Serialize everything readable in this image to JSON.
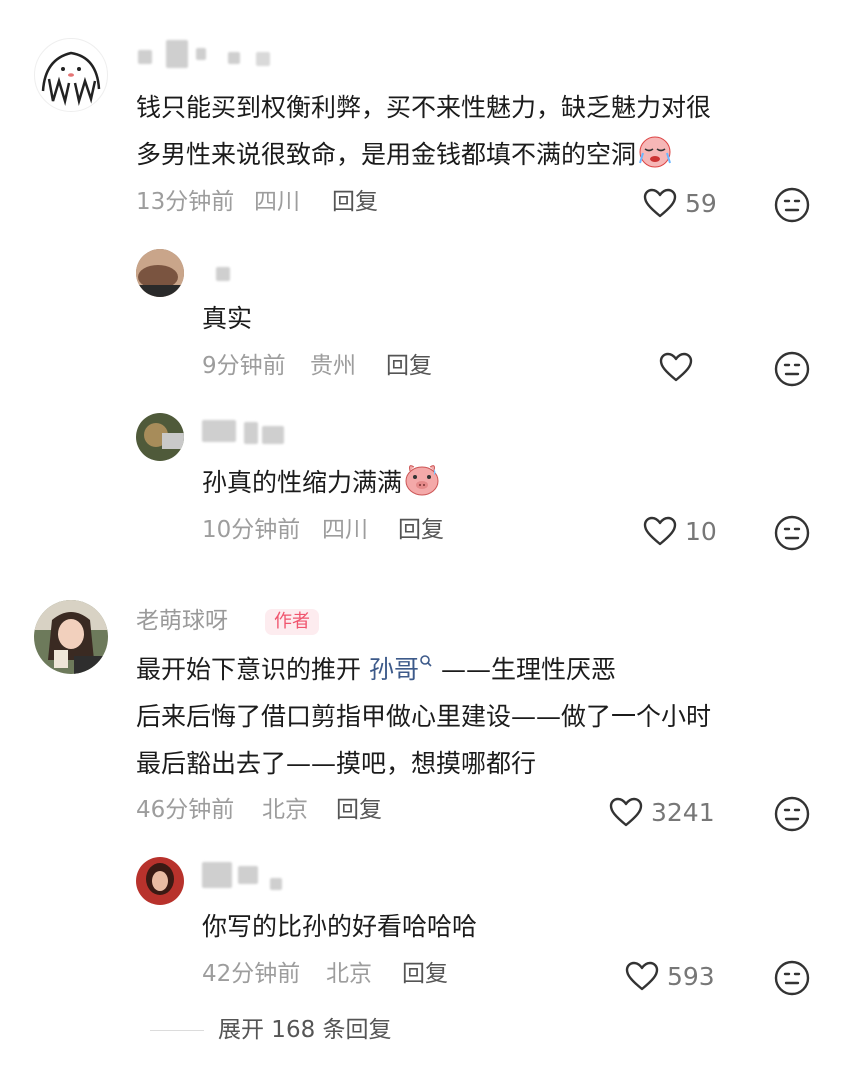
{
  "comments": [
    {
      "lines": [
        "钱只能买到权衡利弊，买不来性魅力，缺乏魅力对很",
        "多男性来说很致命，是用金钱都填不满的空洞"
      ],
      "time": "13分钟前",
      "location": "四川",
      "reply_label": "回复",
      "likes": "59",
      "replies": [
        {
          "text": "真实",
          "time": "9分钟前",
          "location": "贵州",
          "reply_label": "回复",
          "likes": ""
        },
        {
          "text": "孙真的性缩力满满",
          "time": "10分钟前",
          "location": "四川",
          "reply_label": "回复",
          "likes": "10"
        }
      ]
    },
    {
      "username": "老萌球呀",
      "badge": "作者",
      "line1_before": "最开始下意识的推开",
      "line1_link": "孙哥",
      "line1_after": "——生理性厌恶",
      "line2": "后来后悔了借口剪指甲做心里建设——做了一个小时",
      "line3": "最后豁出去了——摸吧，想摸哪都行",
      "time": "46分钟前",
      "location": "北京",
      "reply_label": "回复",
      "likes": "3241",
      "replies": [
        {
          "text": "你写的比孙的好看哈哈哈",
          "time": "42分钟前",
          "location": "北京",
          "reply_label": "回复",
          "likes": "593"
        }
      ]
    }
  ],
  "expand_label": "展开 168 条回复",
  "icons": {
    "like": "heart-outline-icon",
    "dislike": "neutral-face-icon",
    "search": "search-icon"
  },
  "colors": {
    "author_badge": "#f0556e",
    "link": "#3d5a8a",
    "meta": "#9d9d9d"
  }
}
